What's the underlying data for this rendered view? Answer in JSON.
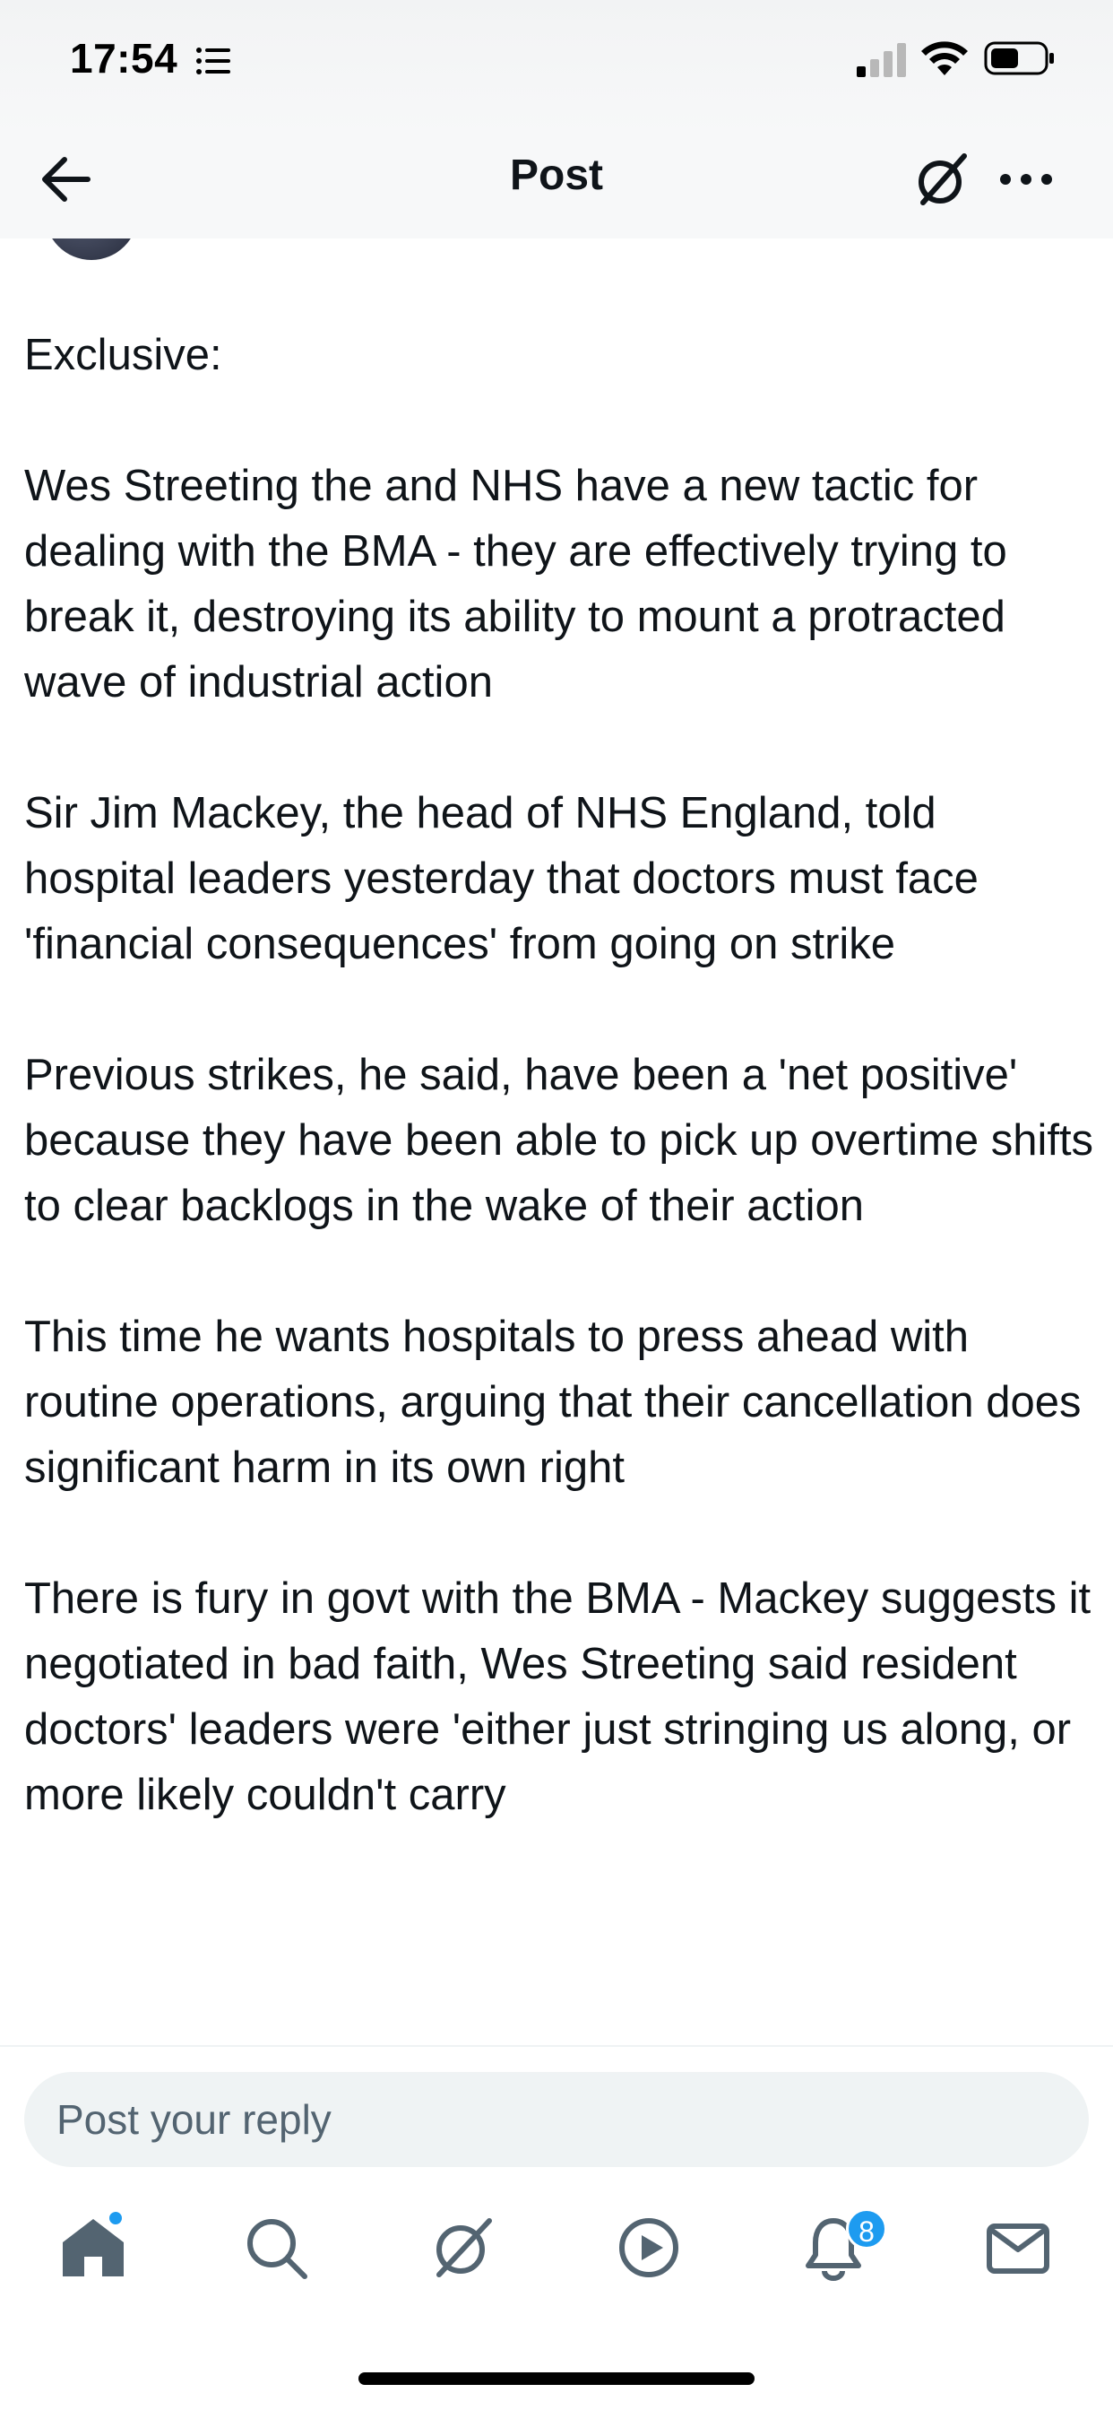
{
  "status_bar": {
    "time": "17:54",
    "icons": [
      "list-icon",
      "signal-icon",
      "wifi-icon",
      "battery-icon"
    ]
  },
  "header": {
    "title": "Post",
    "icons": [
      "back-arrow-icon",
      "grok-icon",
      "more-icon"
    ]
  },
  "post": {
    "paragraphs": [
      "Exclusive:",
      "Wes Streeting the and NHS have a new tactic for dealing with the BMA - they are effectively trying to break it, destroying its ability to mount a protracted wave of industrial action",
      "Sir Jim Mackey, the head of NHS England, told hospital leaders yesterday that doctors must face 'financial consequences' from going on strike",
      "Previous strikes, he said, have been a 'net positive' because they have been able to pick up overtime shifts to clear backlogs in the wake of their action",
      "This time he wants hospitals to press ahead with routine operations, arguing that their cancellation does significant harm in its own right",
      "There is fury in govt with the BMA - Mackey suggests it negotiated in bad faith, Wes Streeting said resident doctors' leaders were 'either just stringing us along, or more likely couldn't carry"
    ]
  },
  "reply": {
    "placeholder": "Post your reply"
  },
  "tab_bar": {
    "items": [
      "home-icon",
      "search-icon",
      "grok-icon",
      "video-icon",
      "notifications-icon",
      "messages-icon"
    ],
    "notification_count": "8"
  },
  "colors": {
    "accent": "#1d9bf0",
    "text": "#0f1419",
    "icon_gray": "#536471"
  }
}
